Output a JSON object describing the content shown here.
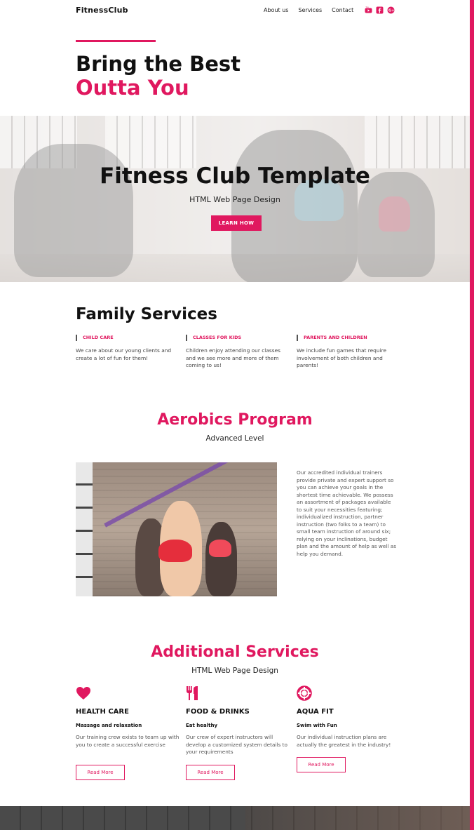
{
  "colors": {
    "accent": "#e0185f",
    "text": "#111111"
  },
  "header": {
    "brand": "FitnessClub",
    "nav": [
      "About us",
      "Services",
      "Contact"
    ],
    "social_icons": [
      "youtube-icon",
      "facebook-icon",
      "google-plus-icon"
    ]
  },
  "intro": {
    "title_line1": "Bring the Best",
    "title_line2": "Outta You"
  },
  "banner": {
    "title": "Fitness Club Template",
    "subtitle": "HTML Web Page Design",
    "button": "LEARN HOW"
  },
  "family": {
    "title": "Family Services",
    "items": [
      {
        "tag": "CHILD CARE",
        "text": "We care about our young clients and create a lot of fun for them!"
      },
      {
        "tag": "CLASSES FOR KIDS",
        "text": "Children enjoy attending our classes and we see more and more of them coming to us!"
      },
      {
        "tag": "PARENTS AND CHILDREN",
        "text": "We include fun games that require involvement of both children and parents!"
      }
    ]
  },
  "aerobics": {
    "title": "Aerobics Program",
    "subtitle": "Advanced Level",
    "text": "Our accredited individual trainers provide private and expert support so you can achieve your goals in the shortest time achievable. We possess an assortment of packages available to suit your necessities featuring; individualized instruction, partner instruction (two folks to a team) to small team instruction of around six; relying on your inclinations, budget plan and the amount of help as well as help you demand."
  },
  "additional": {
    "title": "Additional Services",
    "subtitle": "HTML Web Page Design",
    "items": [
      {
        "icon": "heart-icon",
        "name": "HEALTH CARE",
        "sub": "Massage and relaxation",
        "text": "Our training crew exists to team up with you to create a successful exercise",
        "button": "Read More"
      },
      {
        "icon": "fork-knife-icon",
        "name": "FOOD & DRINKS",
        "sub": "Eat healthy",
        "text": "Our crew of expert instructors will develop a customized system details to your requirements",
        "button": "Read More"
      },
      {
        "icon": "lifebuoy-icon",
        "name": "AQUA FIT",
        "sub": "Swim with Fun",
        "text": "Our individual instruction plans are actually the greatest in the industry!",
        "button": "Read More"
      }
    ]
  }
}
